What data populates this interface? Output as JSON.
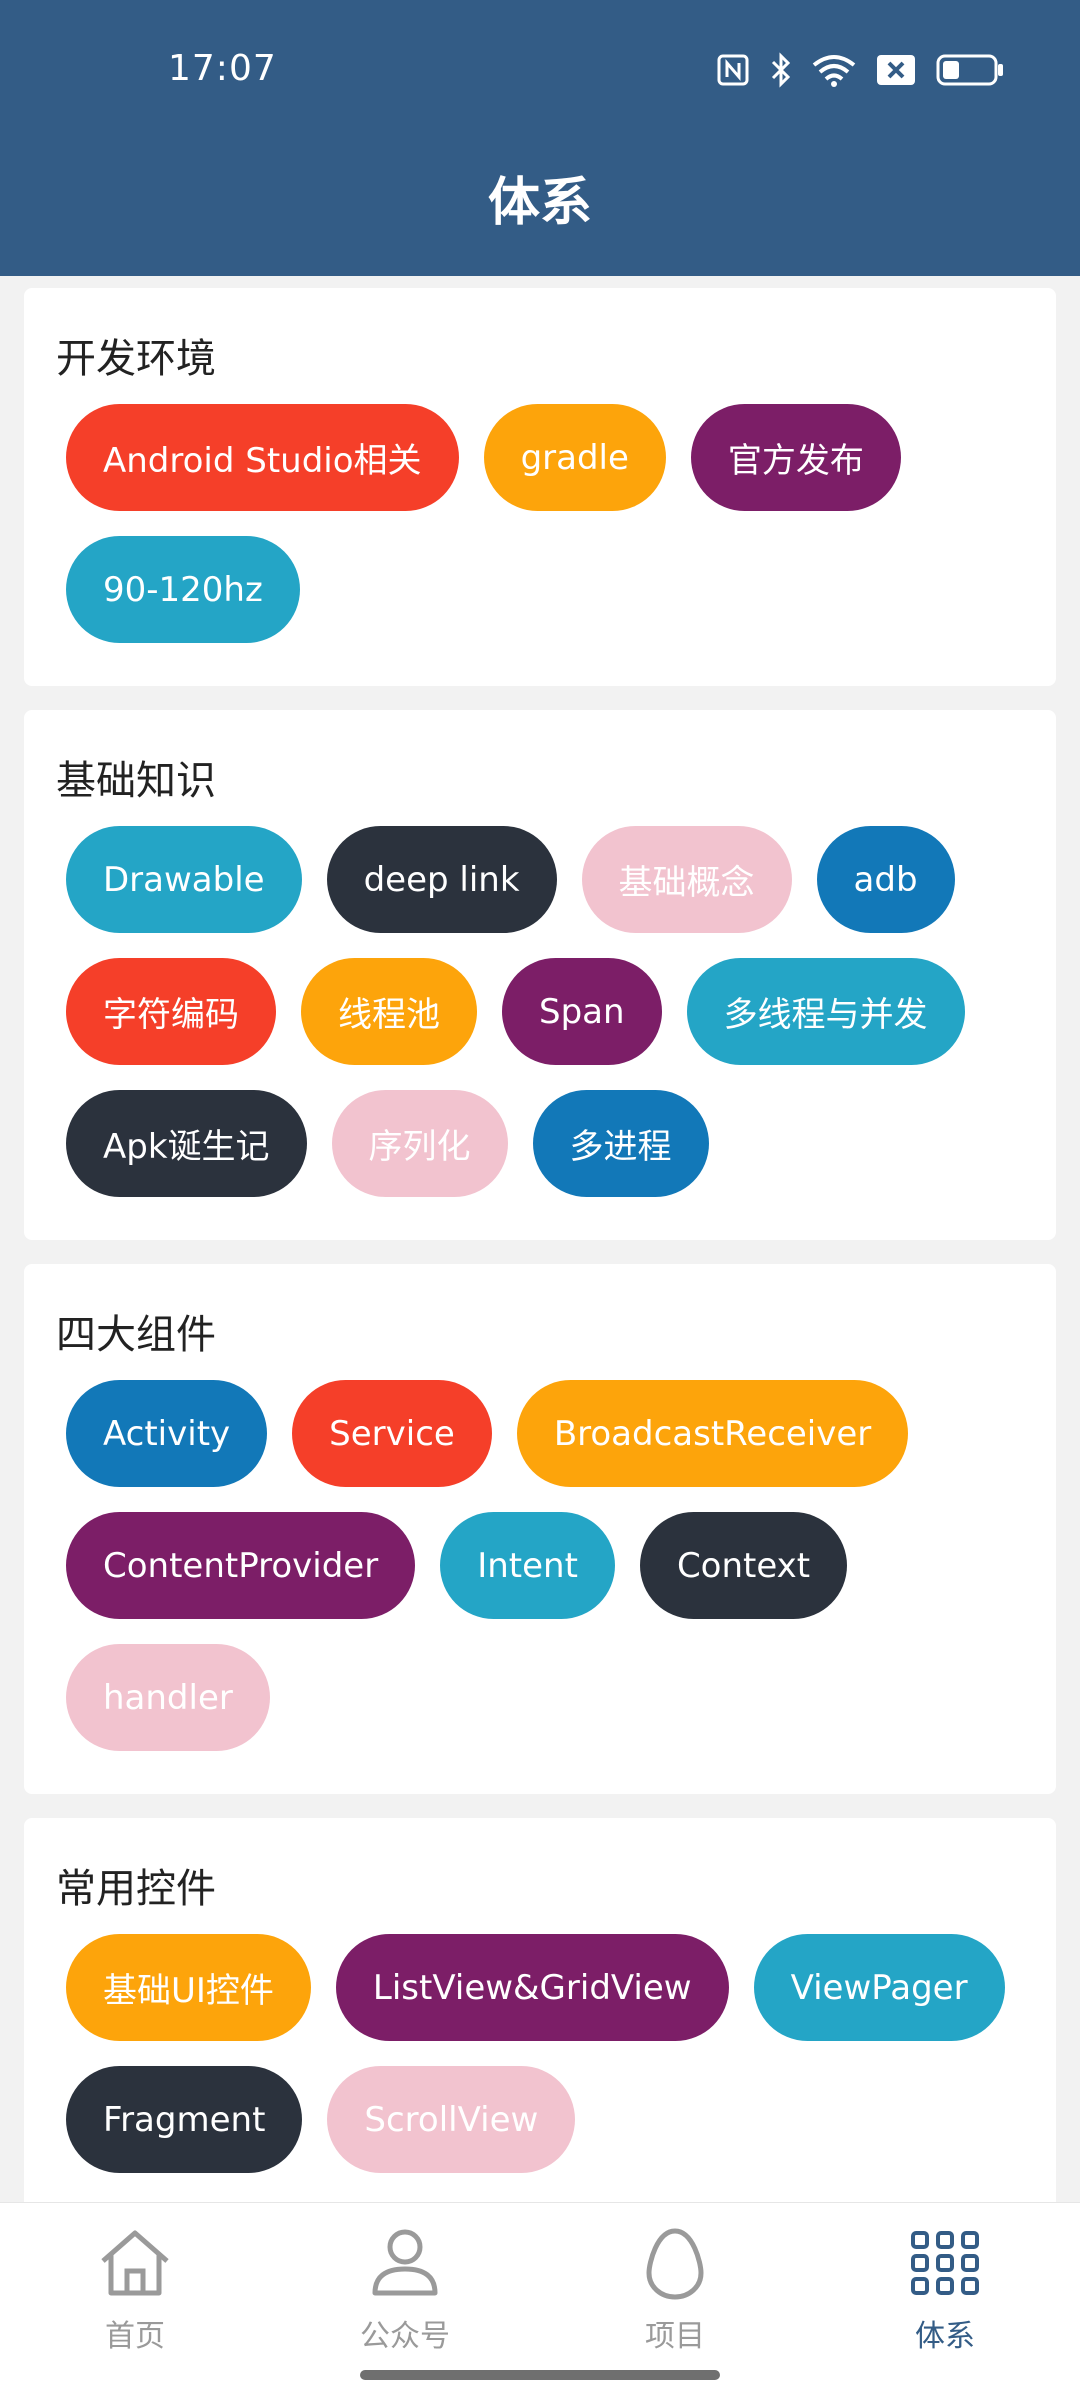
{
  "status_bar": {
    "time": "17:07"
  },
  "header": {
    "title": "体系"
  },
  "sections": [
    {
      "title": "开发环境",
      "tags": [
        {
          "label": "Android Studio相关",
          "color": "#f53f29"
        },
        {
          "label": "gradle",
          "color": "#fda40b"
        },
        {
          "label": "官方发布",
          "color": "#7c1e67"
        },
        {
          "label": "90-120hz",
          "color": "#24a5c6"
        }
      ]
    },
    {
      "title": "基础知识",
      "tags": [
        {
          "label": "Drawable",
          "color": "#24a5c6"
        },
        {
          "label": "deep link",
          "color": "#2b323d"
        },
        {
          "label": "基础概念",
          "color": "#f2c3cf"
        },
        {
          "label": "adb",
          "color": "#1278b8"
        },
        {
          "label": "字符编码",
          "color": "#f53f29"
        },
        {
          "label": "线程池",
          "color": "#fda40b"
        },
        {
          "label": "Span",
          "color": "#7c1e67"
        },
        {
          "label": "多线程与并发",
          "color": "#24a5c6"
        },
        {
          "label": "Apk诞生记",
          "color": "#2b323d"
        },
        {
          "label": "序列化",
          "color": "#f2c3cf"
        },
        {
          "label": "多进程",
          "color": "#1278b8"
        }
      ]
    },
    {
      "title": "四大组件",
      "tags": [
        {
          "label": "Activity",
          "color": "#1278b8"
        },
        {
          "label": "Service",
          "color": "#f53f29"
        },
        {
          "label": "BroadcastReceiver",
          "color": "#fda40b"
        },
        {
          "label": "ContentProvider",
          "color": "#7c1e67"
        },
        {
          "label": "Intent",
          "color": "#24a5c6"
        },
        {
          "label": "Context",
          "color": "#2b323d"
        },
        {
          "label": "handler",
          "color": "#f2c3cf"
        }
      ]
    },
    {
      "title": "常用控件",
      "tags": [
        {
          "label": "基础UI控件",
          "color": "#fda40b"
        },
        {
          "label": "ListView&GridView",
          "color": "#7c1e67"
        },
        {
          "label": "ViewPager",
          "color": "#24a5c6"
        },
        {
          "label": "Fragment",
          "color": "#2b323d"
        },
        {
          "label": "ScrollView",
          "color": "#f2c3cf"
        }
      ]
    }
  ],
  "bottom_nav": {
    "items": [
      {
        "label": "首页",
        "icon": "home-icon",
        "active": false
      },
      {
        "label": "公众号",
        "icon": "person-icon",
        "active": false
      },
      {
        "label": "项目",
        "icon": "egg-icon",
        "active": false
      },
      {
        "label": "体系",
        "icon": "grid-icon",
        "active": true
      }
    ],
    "active_color": "#335c86",
    "inactive_color": "#9a9a9a"
  }
}
